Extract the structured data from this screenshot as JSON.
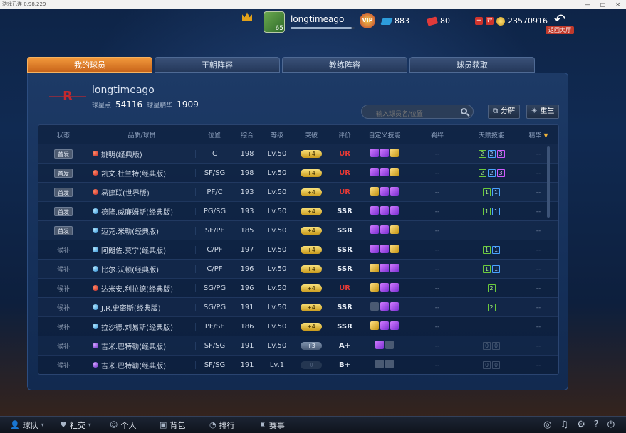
{
  "titlebar": {
    "text": "游戏已连 0.98.229"
  },
  "topbar": {
    "username": "longtimeago",
    "avatar_level": "65",
    "vip_label": "VIP",
    "gems": "883",
    "tickets": "80",
    "coins": "23570916",
    "back_label": "返回大厅",
    "xp_fraction": 0.95
  },
  "tabs": [
    "我的球员",
    "王朝阵容",
    "教练阵容",
    "球员获取"
  ],
  "profile": {
    "name": "longtimeago",
    "points_label": "球星点",
    "points": "54116",
    "essence_label": "球星精华",
    "essence": "1909"
  },
  "search": {
    "placeholder": "输入球员名/位置"
  },
  "buttons": {
    "decompose": "分解",
    "reborn": "重生"
  },
  "table": {
    "headers": {
      "status": "状态",
      "player": "品质/球员",
      "position": "位置",
      "overall": "综合",
      "level": "等级",
      "breakthrough": "突破",
      "rating": "评价",
      "custom_skill": "自定义技能",
      "bond": "羁绊",
      "talent": "天赋技能",
      "essence": "精华"
    },
    "rows": [
      {
        "status": "首发",
        "quality": "red",
        "name": "姚明(经典版)",
        "position": "C",
        "overall": "198",
        "level": "Lv.50",
        "breakthrough": "+4",
        "rating": "UR",
        "skills": [
          "purple",
          "purple",
          "gold"
        ],
        "bond": "--",
        "talents": [
          [
            "2",
            "g"
          ],
          [
            "2",
            "b"
          ],
          [
            "3",
            "p"
          ]
        ],
        "essence": "--"
      },
      {
        "status": "首发",
        "quality": "red",
        "name": "凯文.杜兰特(经典版)",
        "position": "SF/SG",
        "overall": "198",
        "level": "Lv.50",
        "breakthrough": "+4",
        "rating": "UR",
        "skills": [
          "purple",
          "purple",
          "gold"
        ],
        "bond": "--",
        "talents": [
          [
            "2",
            "g"
          ],
          [
            "2",
            "b"
          ],
          [
            "3",
            "p"
          ]
        ],
        "essence": "--"
      },
      {
        "status": "首发",
        "quality": "red",
        "name": "易建联(世界版)",
        "position": "PF/C",
        "overall": "193",
        "level": "Lv.50",
        "breakthrough": "+4",
        "rating": "UR",
        "skills": [
          "gold",
          "purple",
          "purple"
        ],
        "bond": "--",
        "talents": [
          [
            "1",
            "g"
          ],
          [
            "1",
            "b"
          ]
        ],
        "essence": "--"
      },
      {
        "status": "首发",
        "quality": "blue",
        "name": "德隆.威廉姆斯(经典版)",
        "position": "PG/SG",
        "overall": "193",
        "level": "Lv.50",
        "breakthrough": "+4",
        "rating": "SSR",
        "skills": [
          "purple",
          "purple",
          "purple"
        ],
        "bond": "--",
        "talents": [
          [
            "1",
            "g"
          ],
          [
            "1",
            "b"
          ]
        ],
        "essence": "--"
      },
      {
        "status": "首发",
        "quality": "blue",
        "name": "迈克.米勒(经典版)",
        "position": "SF/PF",
        "overall": "185",
        "level": "Lv.50",
        "breakthrough": "+4",
        "rating": "SSR",
        "skills": [
          "purple",
          "purple",
          "gold"
        ],
        "bond": "--",
        "talents": [],
        "essence": "--"
      },
      {
        "status": "候补",
        "quality": "blue",
        "name": "阿朗佐.莫宁(经典版)",
        "position": "C/PF",
        "overall": "197",
        "level": "Lv.50",
        "breakthrough": "+4",
        "rating": "SSR",
        "skills": [
          "purple",
          "purple",
          "gold"
        ],
        "bond": "--",
        "talents": [
          [
            "1",
            "g"
          ],
          [
            "1",
            "b"
          ]
        ],
        "essence": "--"
      },
      {
        "status": "候补",
        "quality": "blue",
        "name": "比尔.沃顿(经典版)",
        "position": "C/PF",
        "overall": "196",
        "level": "Lv.50",
        "breakthrough": "+4",
        "rating": "SSR",
        "skills": [
          "gold",
          "purple",
          "purple"
        ],
        "bond": "--",
        "talents": [
          [
            "1",
            "g"
          ],
          [
            "1",
            "b"
          ]
        ],
        "essence": "--"
      },
      {
        "status": "候补",
        "quality": "red",
        "name": "达米安.利拉德(经典版)",
        "position": "SG/PG",
        "overall": "196",
        "level": "Lv.50",
        "breakthrough": "+4",
        "rating": "UR",
        "skills": [
          "gold",
          "purple",
          "purple"
        ],
        "bond": "--",
        "talents": [
          [
            "2",
            "g"
          ]
        ],
        "essence": "--"
      },
      {
        "status": "候补",
        "quality": "blue",
        "name": "J.R.史密斯(经典版)",
        "position": "SG/PG",
        "overall": "191",
        "level": "Lv.50",
        "breakthrough": "+4",
        "rating": "SSR",
        "skills": [
          "grey",
          "purple",
          "purple"
        ],
        "bond": "--",
        "talents": [
          [
            "2",
            "g"
          ]
        ],
        "essence": "--"
      },
      {
        "status": "候补",
        "quality": "blue",
        "name": "拉沙德.刘易斯(经典版)",
        "position": "PF/SF",
        "overall": "186",
        "level": "Lv.50",
        "breakthrough": "+4",
        "rating": "SSR",
        "skills": [
          "gold",
          "purple",
          "purple"
        ],
        "bond": "--",
        "talents": [],
        "essence": "--"
      },
      {
        "status": "候补",
        "quality": "purple",
        "name": "吉米.巴特勒(经典版)",
        "position": "SF/SG",
        "overall": "191",
        "level": "Lv.50",
        "breakthrough": "+3",
        "rating": "A+",
        "skills": [
          "purple",
          "grey"
        ],
        "bond": "--",
        "talents": [
          [
            "0",
            "d"
          ],
          [
            "0",
            "d"
          ]
        ],
        "essence": "--"
      },
      {
        "status": "候补",
        "quality": "purple",
        "name": "吉米.巴特勒(经典版)",
        "position": "SF/SG",
        "overall": "191",
        "level": "Lv.1",
        "breakthrough": "0",
        "rating": "B+",
        "skills": [
          "grey",
          "grey"
        ],
        "bond": "--",
        "talents": [
          [
            "0",
            "d"
          ],
          [
            "0",
            "d"
          ]
        ],
        "essence": "--"
      }
    ]
  },
  "bottom_nav": [
    "球队",
    "社交",
    "个人",
    "背包",
    "排行",
    "赛事"
  ],
  "colors": {
    "accent": "#f39a3c",
    "ur": "#e53935",
    "panel": "#1d3a66"
  }
}
